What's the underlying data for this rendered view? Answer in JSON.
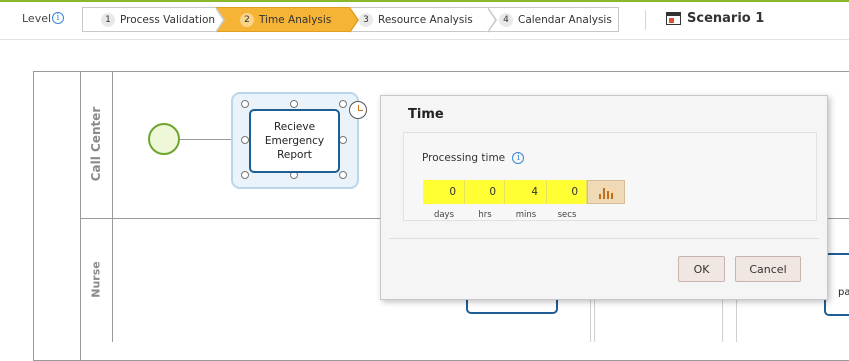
{
  "toolbar": {
    "level_label": "Level",
    "level_info_icon": "i",
    "steps": [
      {
        "num": "1",
        "label": "Process Validation"
      },
      {
        "num": "2",
        "label": "Time Analysis"
      },
      {
        "num": "3",
        "label": "Resource Analysis"
      },
      {
        "num": "4",
        "label": "Calendar Analysis"
      }
    ],
    "active_step": 2,
    "scenario_label": "Scenario 1",
    "colors": {
      "accent_line": "#8ab82c",
      "active_step": "#f5b435"
    }
  },
  "diagram": {
    "lanes": [
      "Call Center",
      "Nurse"
    ],
    "task_label_lines": [
      "Recieve",
      "Emergency",
      "Report"
    ],
    "partial_task_text": "pa"
  },
  "dialog": {
    "title": "Time",
    "processing_label": "Processing time",
    "info_icon": "i",
    "duration": {
      "values": [
        "0",
        "0",
        "4",
        "0"
      ],
      "units": [
        "days",
        "hrs",
        "mins",
        "secs"
      ]
    },
    "chart_icon": "bar-chart-icon",
    "ok_label": "OK",
    "cancel_label": "Cancel",
    "colors": {
      "duration_field": "#ffff33"
    }
  }
}
